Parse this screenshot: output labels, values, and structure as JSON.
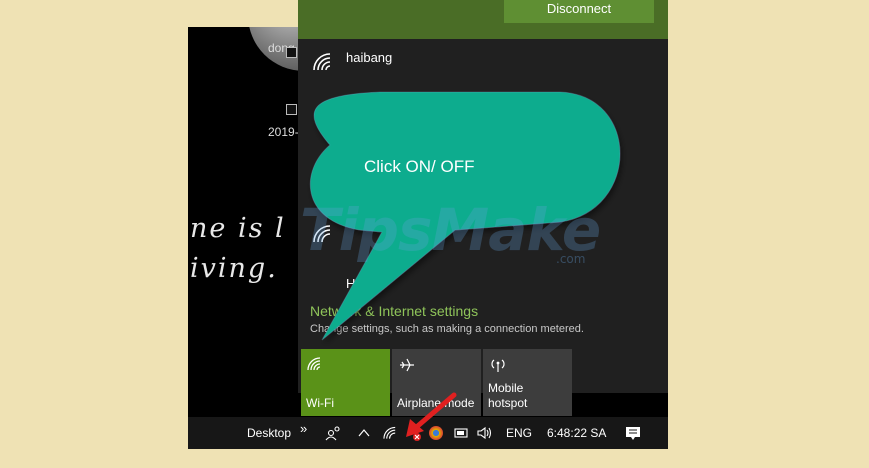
{
  "desktop": {
    "icon_label_top": "dong",
    "icon_label_date": "2019-",
    "script_line1": "ne is l",
    "script_line2": "iving."
  },
  "network_panel": {
    "disconnect_label": "Disconnect",
    "networks": [
      {
        "name": "haibang"
      },
      {
        "name": ""
      },
      {
        "name": "Hu"
      }
    ],
    "settings_title": "Network & Internet settings",
    "settings_subtitle": "Change settings, such as making a connection metered."
  },
  "quick_actions": [
    {
      "label": "Wi-Fi",
      "active": true,
      "icon": "wifi-icon"
    },
    {
      "label": "Airplane mode",
      "active": false,
      "icon": "airplane-icon"
    },
    {
      "label_line1": "Mobile",
      "label_line2": "hotspot",
      "active": false,
      "icon": "hotspot-icon"
    }
  ],
  "taskbar": {
    "desktop_label": "Desktop",
    "more_glyph": "»",
    "language": "ENG",
    "clock": "6:48:22 SA"
  },
  "annotation": {
    "callout_text": "Click  ON/ OFF",
    "watermark": "TipsMake",
    "watermark_suffix": ".com"
  },
  "colors": {
    "accent_green": "#5a9218",
    "callout_teal": "#0aac8e",
    "arrow_red": "#e02020",
    "frame_bg": "#efe2b4"
  }
}
